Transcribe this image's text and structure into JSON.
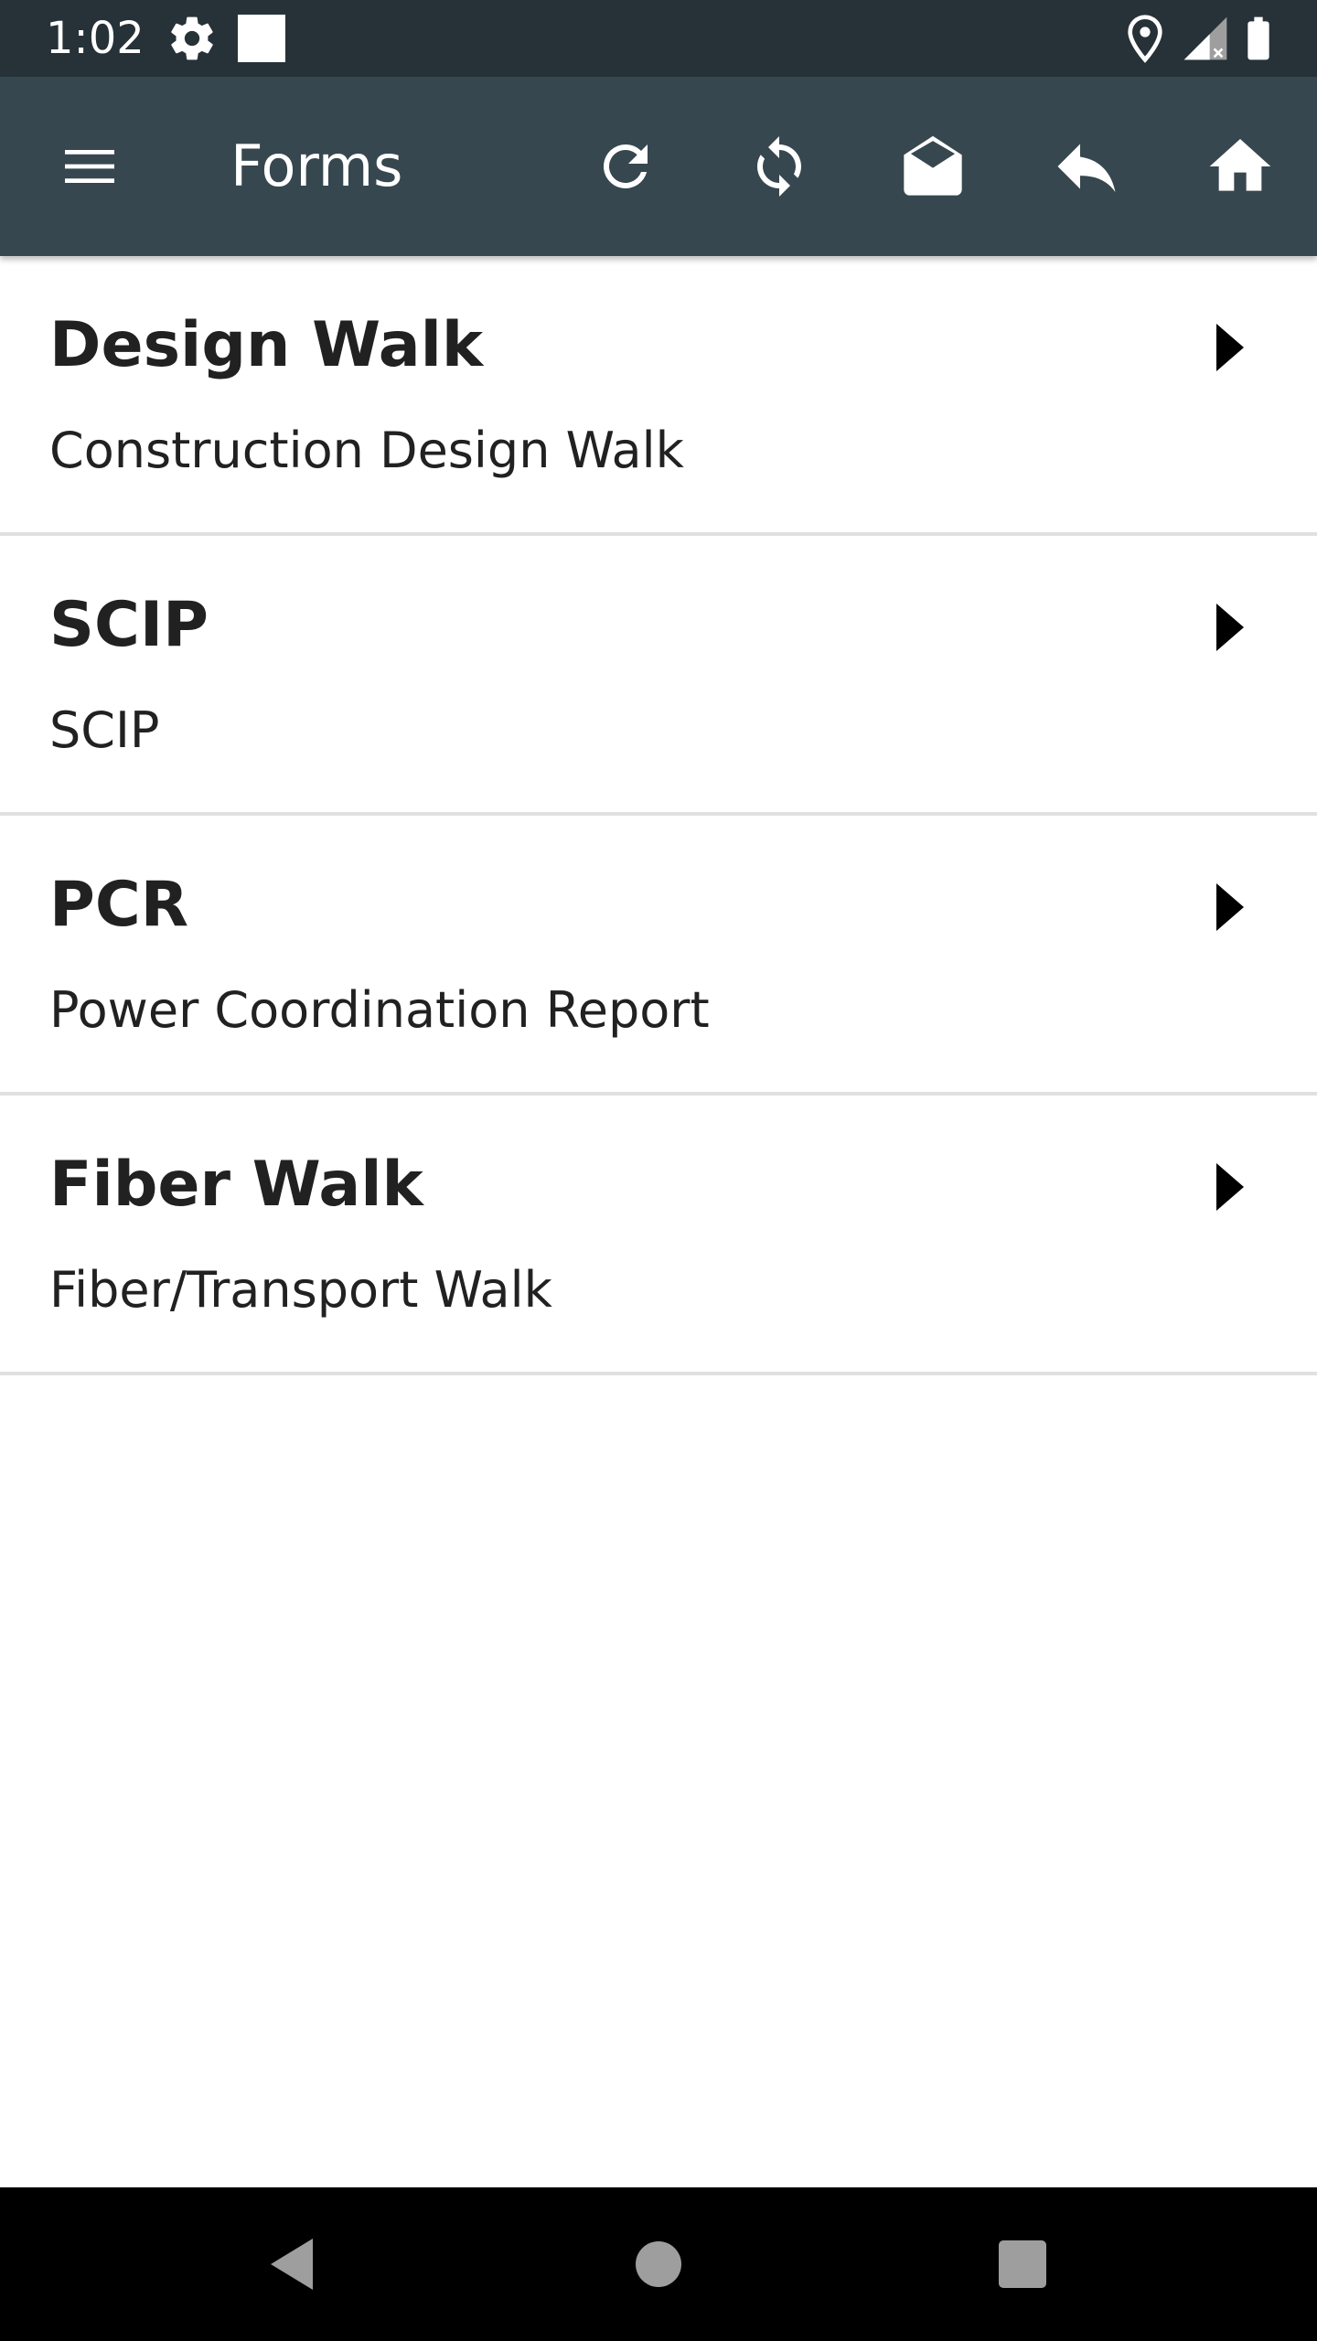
{
  "status_bar": {
    "time": "1:02",
    "icons": [
      "gear-icon",
      "square-notification-icon",
      "location-icon",
      "signal-icon",
      "battery-icon"
    ]
  },
  "toolbar": {
    "title": "Forms",
    "background": "#37474f",
    "actions": [
      "menu-icon",
      "refresh-icon",
      "sync-icon",
      "open-envelope-icon",
      "reply-icon",
      "home-icon"
    ]
  },
  "forms": [
    {
      "title": "Design Walk",
      "subtitle": "Construction Design Walk"
    },
    {
      "title": "SCIP",
      "subtitle": "SCIP"
    },
    {
      "title": "PCR",
      "subtitle": "Power Coordination Report"
    },
    {
      "title": "Fiber Walk",
      "subtitle": "Fiber/Transport Walk"
    }
  ],
  "nav_bar": {
    "buttons": [
      "back-icon",
      "home-circle-icon",
      "recents-icon"
    ]
  }
}
